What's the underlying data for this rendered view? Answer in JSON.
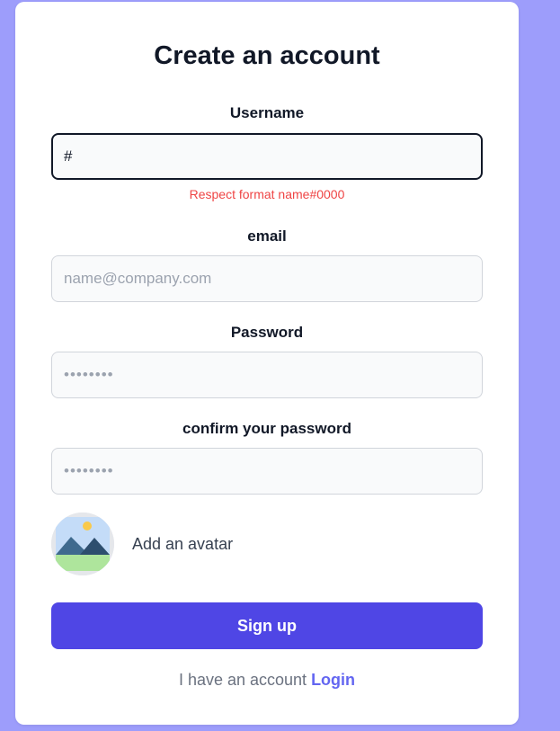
{
  "form": {
    "title": "Create an account",
    "username": {
      "label": "Username",
      "value": "#",
      "error": "Respect format name#0000"
    },
    "email": {
      "label": "email",
      "placeholder": "name@company.com"
    },
    "password": {
      "label": "Password",
      "placeholder": "••••••••"
    },
    "confirm_password": {
      "label": "confirm your password",
      "placeholder": "••••••••"
    },
    "avatar": {
      "label": "Add an avatar",
      "icon": "image-icon"
    },
    "submit_label": "Sign up",
    "footer": {
      "text": "I have an account ",
      "link_label": "Login"
    }
  },
  "colors": {
    "background": "#9d9dfb",
    "accent": "#4f46e5",
    "link": "#6366f1",
    "error": "#ef4444"
  }
}
